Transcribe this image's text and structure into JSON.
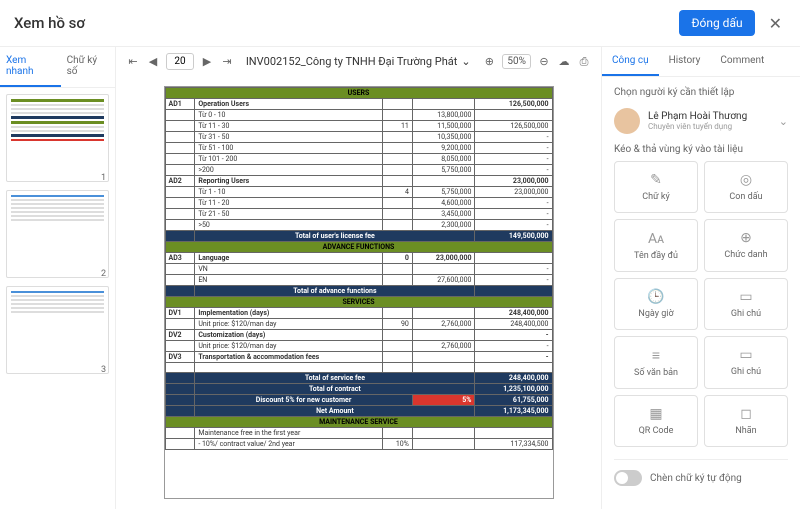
{
  "header": {
    "title": "Xem hồ sơ",
    "stamp_btn": "Đóng dấu"
  },
  "left_tabs": {
    "quick": "Xem nhanh",
    "digisign": "Chữ ký số"
  },
  "thumbs": [
    {
      "n": "1"
    },
    {
      "n": "2"
    },
    {
      "n": "3"
    }
  ],
  "toolbar": {
    "page": "20",
    "doc_title": "INV002152_Công ty TNHH Đại Trường Phát",
    "zoom": "50%"
  },
  "doc": {
    "users_hdr": "USERS",
    "ad1": "AD1",
    "op_users": "Operation Users",
    "op_rows": [
      {
        "label": "Từ 0 - 10",
        "c1": "",
        "c2": "13,800,000",
        "c3": "126,500,000"
      },
      {
        "label": "Từ 11 - 30",
        "c1": "11",
        "c2": "11,500,000",
        "c3": "126,500,000"
      },
      {
        "label": "Từ 31 - 50",
        "c1": "",
        "c2": "10,350,000",
        "c3": "-"
      },
      {
        "label": "Từ 51 - 100",
        "c1": "",
        "c2": "9,200,000",
        "c3": "-"
      },
      {
        "label": "Từ 101 - 200",
        "c1": "",
        "c2": "8,050,000",
        "c3": "-"
      },
      {
        "label": ">200",
        "c1": "",
        "c2": "5,750,000",
        "c3": "-"
      }
    ],
    "ad2": "AD2",
    "rep_users": "Reporting Users",
    "rep_total": "23,000,000",
    "rep_rows": [
      {
        "label": "Từ 1 - 10",
        "c1": "4",
        "c2": "5,750,000",
        "c3": "23,000,000"
      },
      {
        "label": "Từ 11 - 20",
        "c1": "",
        "c2": "4,600,000",
        "c3": "-"
      },
      {
        "label": "Từ 21 - 50",
        "c1": "",
        "c2": "3,450,000",
        "c3": "-"
      },
      {
        "label": ">50",
        "c1": "",
        "c2": "2,300,000",
        "c3": "-"
      }
    ],
    "total_license": "Total of user's license fee",
    "total_license_val": "149,500,000",
    "adv_hdr": "ADVANCE FUNCTIONS",
    "ad3": "AD3",
    "lang": "Language",
    "lang_q": "0",
    "lang_v": "23,000,000",
    "vn": "VN",
    "en": "EN",
    "en_v": "27,600,000",
    "total_adv": "Total of  advance functions",
    "svc_hdr": "SERVICES",
    "dv1": "DV1",
    "impl": "Implementation (days)",
    "impl_total": "248,400,000",
    "unit120": "Unit price: $120/man day",
    "unit120_q": "90",
    "unit120_v": "2,760,000",
    "unit120_t": "248,400,000",
    "dv2": "DV2",
    "cust": "Customization (days)",
    "unit120b": "Unit price: $120/man day",
    "unit120b_v": "2,760,000",
    "dv3": "DV3",
    "trans": "Transportation & accommodation  fees",
    "total_svc": "Total of service fee",
    "total_svc_v": "248,400,000",
    "total_contract": "Total of contract",
    "total_contract_v": "1,235,100,000",
    "discount": "Discount 5% for new customer",
    "discount_pct": "5%",
    "discount_v": "61,755,000",
    "net": "Net Amount",
    "net_v": "1,173,345,000",
    "maint_hdr": "MAINTENANCE SERVICE",
    "maint1": "Maintenance free in the first year",
    "maint2": "- 10%/ contract value/ 2nd year",
    "maint2_q": "10%",
    "maint2_v": "117,334,500"
  },
  "right": {
    "tabs": {
      "tools": "Công cụ",
      "history": "History",
      "comment": "Comment"
    },
    "select_signer": "Chọn người ký cần thiết lập",
    "signer": {
      "name": "Lê Phạm Hoài Thương",
      "role": "Chuyên viên tuyển dụng"
    },
    "drag_label": "Kéo & thả vùng ký vào tài liệu",
    "tiles": [
      {
        "icon": "✎",
        "label": "Chữ ký"
      },
      {
        "icon": "◎",
        "label": "Con dấu"
      },
      {
        "icon": "Aᴀ",
        "label": "Tên đầy đủ"
      },
      {
        "icon": "⊕",
        "label": "Chức danh"
      },
      {
        "icon": "🕒",
        "label": "Ngày giờ"
      },
      {
        "icon": "▭",
        "label": "Ghi chú"
      },
      {
        "icon": "≡",
        "label": "Số văn bản"
      },
      {
        "icon": "▭",
        "label": "Ghi chú"
      },
      {
        "icon": "▦",
        "label": "QR Code"
      },
      {
        "icon": "◻",
        "label": "Nhãn"
      }
    ],
    "auto_sign": "Chèn chữ ký tự động"
  }
}
